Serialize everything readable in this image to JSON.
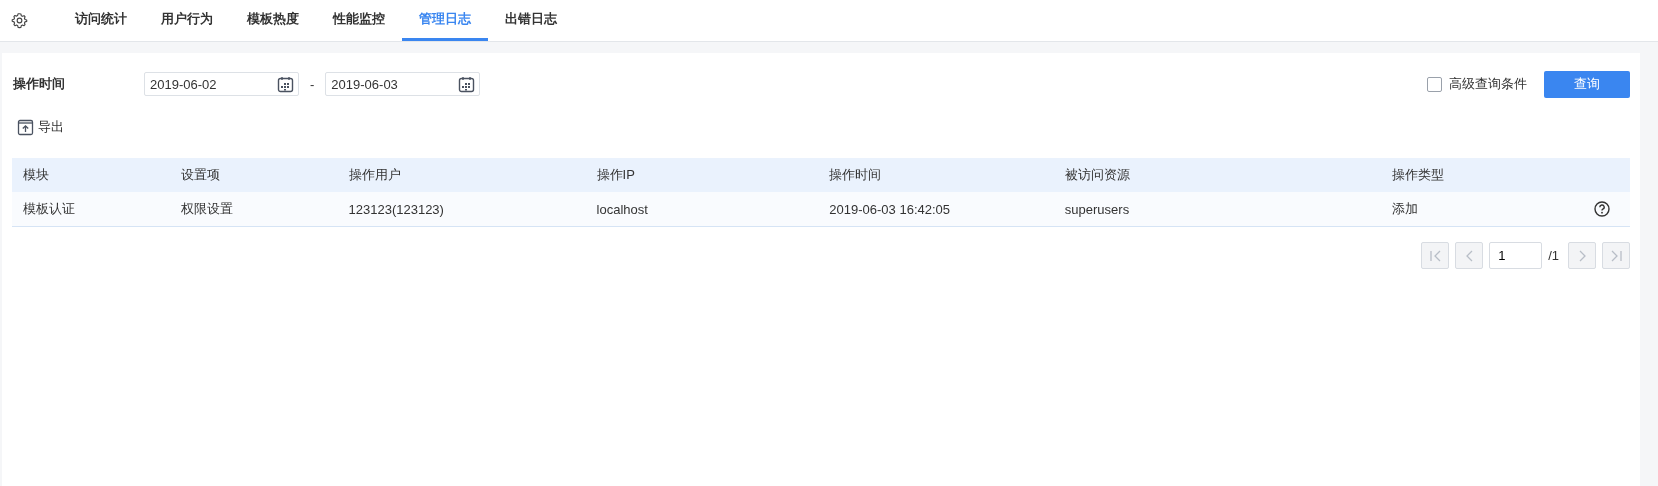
{
  "tabs": [
    {
      "label": "访问统计",
      "selected": false
    },
    {
      "label": "用户行为",
      "selected": false
    },
    {
      "label": "模板热度",
      "selected": false
    },
    {
      "label": "性能监控",
      "selected": false
    },
    {
      "label": "管理日志",
      "selected": true
    },
    {
      "label": "出错日志",
      "selected": false
    }
  ],
  "filter": {
    "label": "操作时间",
    "start_date": "2019-06-02",
    "separator": "-",
    "end_date": "2019-06-03",
    "advanced": {
      "label": "高级查询条件",
      "checked": false
    },
    "query_button": "查询"
  },
  "export_button": "导出",
  "table": {
    "columns": [
      "模块",
      "设置项",
      "操作用户",
      "操作IP",
      "操作时间",
      "被访问资源",
      "操作类型"
    ],
    "rows": [
      {
        "cells": [
          "模板认证",
          "权限设置",
          "123123(123123)",
          "localhost",
          "2019-06-03 16:42:05",
          "superusers",
          "添加"
        ]
      }
    ]
  },
  "pagination": {
    "page": "1",
    "total": "/1",
    "buttons": [
      {
        "kind": "first",
        "disabled": true
      },
      {
        "kind": "prev",
        "disabled": true
      },
      {
        "kind": "next",
        "disabled": true
      },
      {
        "kind": "last",
        "disabled": true
      }
    ]
  }
}
